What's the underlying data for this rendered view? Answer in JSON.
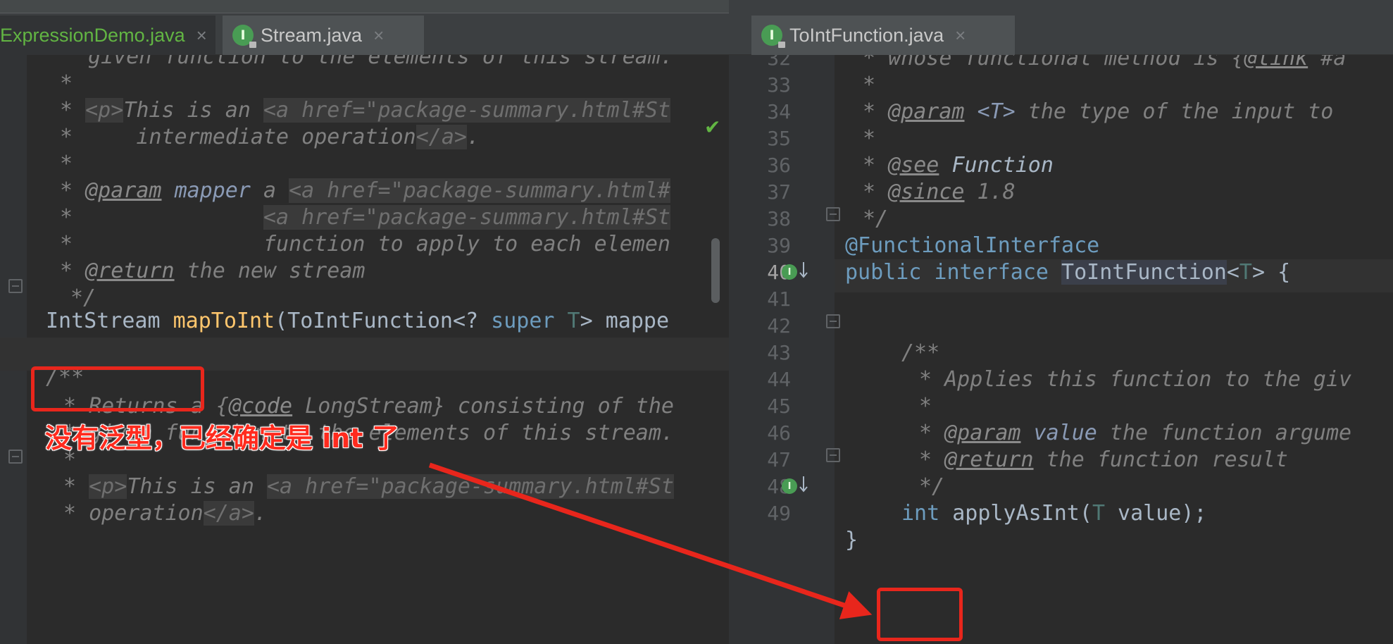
{
  "tabs_left": [
    {
      "label": "ExpressionDemo.java",
      "close": "×"
    },
    {
      "label": "Stream.java",
      "icon": "I",
      "close": "×"
    }
  ],
  "tabs_right": [
    {
      "label": "ToIntFunction.java",
      "icon": "I",
      "close": "×"
    }
  ],
  "left_lines": [
    "given function to the elements of this stream.",
    "*",
    "* <p>This is an <a href=\"package-summary.html#St",
    "*     intermediate operation</a>.",
    "*",
    "* @param mapper a <a href=\"package-summary.html#",
    "*               <a href=\"package-summary.html#St",
    "*               function to apply to each elemen",
    "* @return the new stream",
    "*/",
    "IntStream mapToInt(ToIntFunction<? super T> mappe",
    "",
    "/**",
    "* Returns a {@code LongStream} consisting of the",
    "* given function to the elements of this stream.",
    "*",
    "* <p>This is an <a href=\"package-summary.html#St",
    "* operation</a>."
  ],
  "right_lines": [
    {
      "num": "32",
      "text": "* whose functional method is {@link #a"
    },
    {
      "num": "33",
      "text": "*"
    },
    {
      "num": "34",
      "text": "* @param <T> the type of the input to"
    },
    {
      "num": "35",
      "text": "*"
    },
    {
      "num": "36",
      "text": "* @see Function"
    },
    {
      "num": "37",
      "text": "* @since 1.8"
    },
    {
      "num": "38",
      "text": "*/"
    },
    {
      "num": "39",
      "text": "@FunctionalInterface"
    },
    {
      "num": "40",
      "text": "public interface ToIntFunction<T> {"
    },
    {
      "num": "41",
      "text": ""
    },
    {
      "num": "42",
      "text": "    /**"
    },
    {
      "num": "43",
      "text": "     * Applies this function to the giv"
    },
    {
      "num": "44",
      "text": "     *"
    },
    {
      "num": "45",
      "text": "     * @param value the function argume"
    },
    {
      "num": "46",
      "text": "     * @return the function result"
    },
    {
      "num": "47",
      "text": "     */"
    },
    {
      "num": "48",
      "text": "    int applyAsInt(T value);"
    },
    {
      "num": "49",
      "text": "}"
    }
  ],
  "annotation": {
    "note": "没有泛型，已经确定是 int 了",
    "color": "#e8261c"
  }
}
